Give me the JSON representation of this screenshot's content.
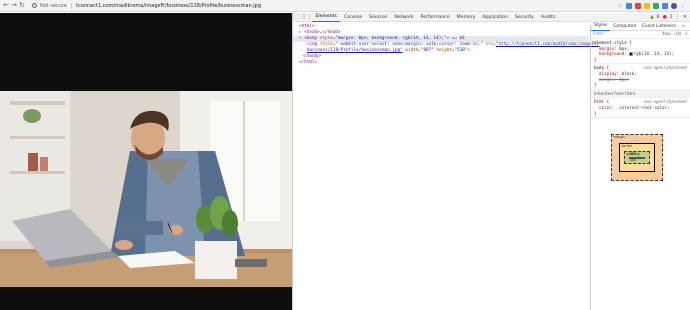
{
  "browser": {
    "security_label": "Not secure",
    "url": "tconnect1.com/madikroma/imageFr/business/118/Profile/businessman.jpg"
  },
  "devtools": {
    "tabs": [
      "Elements",
      "Console",
      "Sources",
      "Network",
      "Performance",
      "Memory",
      "Application",
      "Security",
      "Audits"
    ],
    "active_tab": "Elements",
    "warning_count": "6",
    "error_count": "1",
    "dom": {
      "l1": "<html>",
      "l2_tag": "<head>",
      "l2_rest": "…</head>",
      "l3_tag": "<body",
      "l3_attr": " style=",
      "l3_val": "\"margin: 0px; background: rgb(14, 14, 14);\"",
      "l3_end": "> == $0",
      "l4_tag": "<img",
      "l4_attr1": " style=",
      "l4_val1": "\"-webkit-user-select: none;margin: auto;cursor: zoom-in;\"",
      "l4_attr2": " src=",
      "l4_link": "\"http://tconnect1.com/madikroma/imageFr/",
      "l5_link": "business/118/Profile/businessman.jpg\"",
      "l5_attr1": " width=",
      "l5_val1": "\"807\"",
      "l5_attr2": " height=",
      "l5_val2": "\"538\"",
      "l5_end": ">",
      "l6": "</body>",
      "l7": "</html>"
    }
  },
  "styles": {
    "tabs": [
      "Styles",
      "Computed",
      "Event Listeners",
      "»"
    ],
    "active_tab": "Styles",
    "filter_placeholder": "Filter",
    "filter_hov": ":hov",
    "filter_cls": ".cls",
    "filter_add": "+",
    "rules": {
      "element_sel": "element.style {",
      "p1_name": "margin",
      "p1_val": ": 0px;",
      "p2_name": "background",
      "p2_val": "rgb(14, 14, 14);",
      "close": "}",
      "body_sel": "body {",
      "ua_label": "user agent stylesheet",
      "p3_name": "display",
      "p3_val": ": block;",
      "p4": "margin: 8px;",
      "inherited_label": "Inherited from html",
      "html_sel": "html {",
      "p5_name": "color",
      "p5_val": ": -internal-root-color;"
    },
    "box_model": {
      "margin_label": "margin",
      "border_label": "border",
      "padding_label": "padding",
      "content_size": "807 × 306",
      "dash": "–"
    }
  },
  "colors": {
    "page_background": "#0e0e0e",
    "accent": "#1a73e8"
  }
}
